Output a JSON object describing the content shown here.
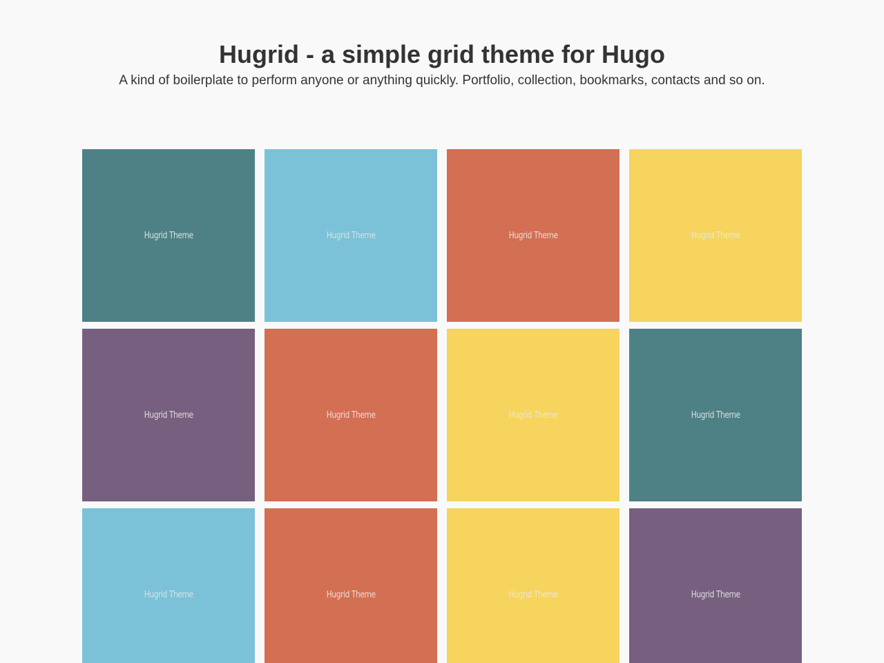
{
  "header": {
    "title": "Hugrid - a simple grid theme for Hugo",
    "subtitle": "A kind of boilerplate to perform anyone or anything quickly. Portfolio, collection, bookmarks, contacts and so on."
  },
  "colors": {
    "teal": "#4d8186",
    "sky": "#7bc1d7",
    "coral": "#d36f52",
    "yellow": "#f6d45e",
    "purple": "#77607f",
    "background": "#f9f9f9",
    "text": "#333333"
  },
  "grid": {
    "items": [
      {
        "label": "Hugrid Theme",
        "color": "#4d8186"
      },
      {
        "label": "Hugrid Theme",
        "color": "#7bc1d7"
      },
      {
        "label": "Hugrid Theme",
        "color": "#d36f52"
      },
      {
        "label": "Hugrid Theme",
        "color": "#f6d45e"
      },
      {
        "label": "Hugrid Theme",
        "color": "#77607f"
      },
      {
        "label": "Hugrid Theme",
        "color": "#d36f52"
      },
      {
        "label": "Hugrid Theme",
        "color": "#f6d45e"
      },
      {
        "label": "Hugrid Theme",
        "color": "#4d8186"
      },
      {
        "label": "Hugrid Theme",
        "color": "#7bc1d7"
      },
      {
        "label": "Hugrid Theme",
        "color": "#d36f52"
      },
      {
        "label": "Hugrid Theme",
        "color": "#f6d45e"
      },
      {
        "label": "Hugrid Theme",
        "color": "#77607f"
      }
    ]
  }
}
